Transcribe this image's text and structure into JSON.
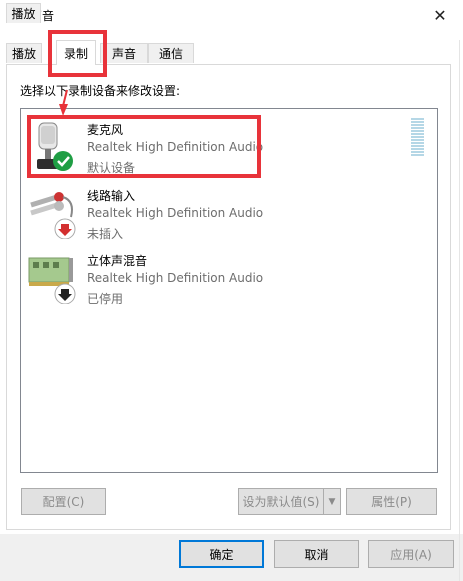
{
  "window": {
    "title": "声音",
    "close_glyph": "✕"
  },
  "tabs": [
    {
      "label": "播放"
    },
    {
      "label": "录制",
      "active": true
    },
    {
      "label": "声音"
    },
    {
      "label": "通信"
    }
  ],
  "instruction": "选择以下录制设备来修改设置:",
  "devices": [
    {
      "name": "麦克风",
      "driver": "Realtek High Definition Audio",
      "status": "默认设备",
      "icon": "microphone-icon",
      "badge": "default-check-badge-icon",
      "badge_color": "#1f9e44"
    },
    {
      "name": "线路输入",
      "driver": "Realtek High Definition Audio",
      "status": "未插入",
      "icon": "line-in-cable-icon",
      "badge": "unplugged-arrow-badge-icon",
      "badge_color": "#d32f2f"
    },
    {
      "name": "立体声混音",
      "driver": "Realtek High Definition Audio",
      "status": "已停用",
      "icon": "sound-card-icon",
      "badge": "disabled-arrow-badge-icon",
      "badge_color": "#222222"
    }
  ],
  "buttons": {
    "configure": "配置(C)",
    "set_default": "设为默认值(S)",
    "properties": "属性(P)",
    "ok": "确定",
    "cancel": "取消",
    "apply": "应用(A)"
  },
  "colors": {
    "annotation": "#e8333a",
    "focus": "#0078d7",
    "level_meter": "#b5d7e6"
  }
}
